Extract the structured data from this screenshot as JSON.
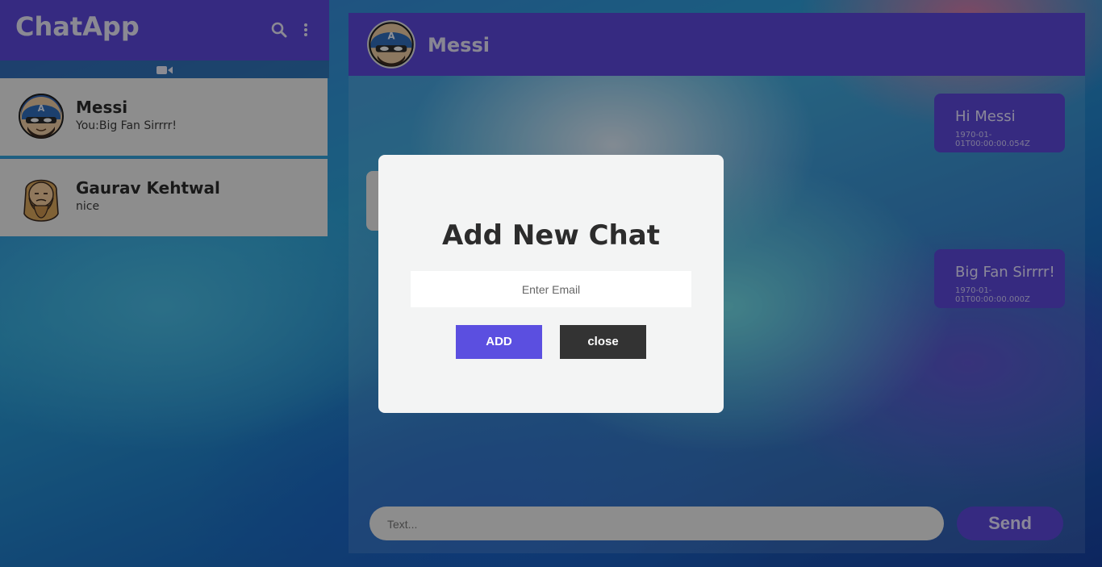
{
  "sidebar": {
    "app_title": "ChatApp",
    "icons": [
      "search-icon",
      "more-vertical-icon",
      "video-icon"
    ],
    "chats": [
      {
        "name": "Messi",
        "preview": "You:Big Fan Sirrrr!",
        "avatar": "captain-avatar"
      },
      {
        "name": "Gaurav Kehtwal",
        "preview": "nice",
        "avatar": "bearded-avatar"
      }
    ]
  },
  "main": {
    "contact_name": "Messi",
    "messages": [
      {
        "text": "Hi Messi",
        "timestamp": "1970-01-01T00:00:00.054Z",
        "side": "right"
      },
      {
        "text": "Big Fan Sirrrr!",
        "timestamp": "1970-01-01T00:00:00.000Z",
        "side": "right"
      }
    ],
    "composer_placeholder": "Text...",
    "send_label": "Send"
  },
  "modal": {
    "title": "Add New Chat",
    "email_placeholder": "Enter Email",
    "add_label": "ADD",
    "close_label": "close"
  },
  "colors": {
    "accent": "#5b46d8",
    "modal_bg": "#f3f4f4",
    "close_button": "#333333",
    "add_button": "#5b4fe0"
  }
}
